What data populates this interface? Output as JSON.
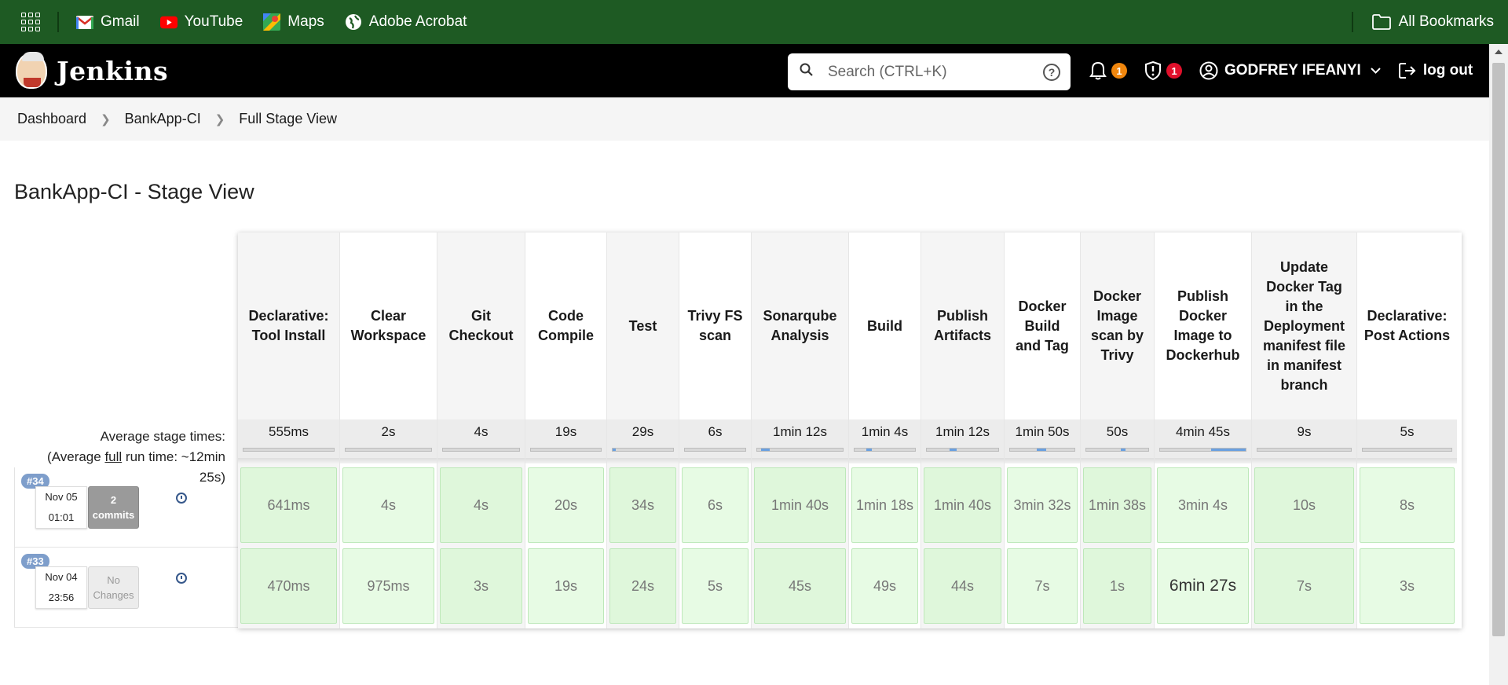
{
  "bookmarks": {
    "items": [
      {
        "label": "Gmail",
        "icon": "gmail-icon"
      },
      {
        "label": "YouTube",
        "icon": "youtube-icon"
      },
      {
        "label": "Maps",
        "icon": "maps-icon"
      },
      {
        "label": "Adobe Acrobat",
        "icon": "globe-icon"
      }
    ],
    "all_bookmarks": "All Bookmarks"
  },
  "header": {
    "app_name": "Jenkins",
    "search_placeholder": "Search (CTRL+K)",
    "notifications_count": "1",
    "security_count": "1",
    "user_name": "GODFREY IFEANYI",
    "logout": "log out",
    "colors": {
      "notification_badge": "#f0860d",
      "security_badge": "#e0102b"
    }
  },
  "breadcrumb": [
    "Dashboard",
    "BankApp-CI",
    "Full Stage View"
  ],
  "page_title": "BankApp-CI - Stage View",
  "avg_label": {
    "line1": "Average stage times:",
    "line2_pre": "(Average ",
    "line2_u": "full",
    "line2_post": " run time: ~12min",
    "line3": "25s)"
  },
  "stages": [
    {
      "name": "Declarative: Tool Install",
      "avg": "555ms",
      "avg_fill": [
        0.0,
        0.0
      ],
      "run34": "641ms",
      "run33": "470ms"
    },
    {
      "name": "Clear Workspace",
      "avg": "2s",
      "avg_fill": [
        0.0,
        0.0
      ],
      "run34": "4s",
      "run33": "975ms"
    },
    {
      "name": "Git Checkout",
      "avg": "4s",
      "avg_fill": [
        0.0,
        0.0
      ],
      "run34": "4s",
      "run33": "3s"
    },
    {
      "name": "Code Compile",
      "avg": "19s",
      "avg_fill": [
        0.0,
        0.0
      ],
      "run34": "20s",
      "run33": "19s"
    },
    {
      "name": "Test",
      "avg": "29s",
      "avg_fill": [
        0.0,
        0.05
      ],
      "run34": "34s",
      "run33": "24s"
    },
    {
      "name": "Trivy FS scan",
      "avg": "6s",
      "avg_fill": [
        0.0,
        0.0
      ],
      "run34": "6s",
      "run33": "5s"
    },
    {
      "name": "Sonarqube Analysis",
      "avg": "1min 12s",
      "avg_fill": [
        0.05,
        0.15
      ],
      "run34": "1min 40s",
      "run33": "45s"
    },
    {
      "name": "Build",
      "avg": "1min 4s",
      "avg_fill": [
        0.2,
        0.28
      ],
      "run34": "1min 18s",
      "run33": "49s"
    },
    {
      "name": "Publish Artifacts",
      "avg": "1min 12s",
      "avg_fill": [
        0.32,
        0.42
      ],
      "run34": "1min 40s",
      "run33": "44s"
    },
    {
      "name": "Docker Build and Tag",
      "avg": "1min 50s",
      "avg_fill": [
        0.42,
        0.56
      ],
      "run34": "3min 32s",
      "run33": "7s"
    },
    {
      "name": "Docker Image scan by Trivy",
      "avg": "50s",
      "avg_fill": [
        0.56,
        0.63
      ],
      "run34": "1min 38s",
      "run33": "1s"
    },
    {
      "name": "Publish Docker Image to Dockerhub",
      "avg": "4min 45s",
      "avg_fill": [
        0.6,
        1.0
      ],
      "run34": "3min 4s",
      "run33": "6min 27s"
    },
    {
      "name": "Update Docker Tag in the Deployment manifest file in manifest branch",
      "avg": "9s",
      "avg_fill": [
        0.0,
        0.0
      ],
      "run34": "10s",
      "run33": "7s"
    },
    {
      "name": "Declarative: Post Actions",
      "avg": "5s",
      "avg_fill": [
        0.0,
        0.0
      ],
      "run34": "8s",
      "run33": "3s"
    }
  ],
  "runs": [
    {
      "badge": "#34",
      "date": "Nov 05",
      "time": "01:01",
      "changes_line1": "2",
      "changes_line2": "commits"
    },
    {
      "badge": "#33",
      "date": "Nov 04",
      "time": "23:56",
      "changes_line1": "No",
      "changes_line2": "Changes"
    }
  ]
}
